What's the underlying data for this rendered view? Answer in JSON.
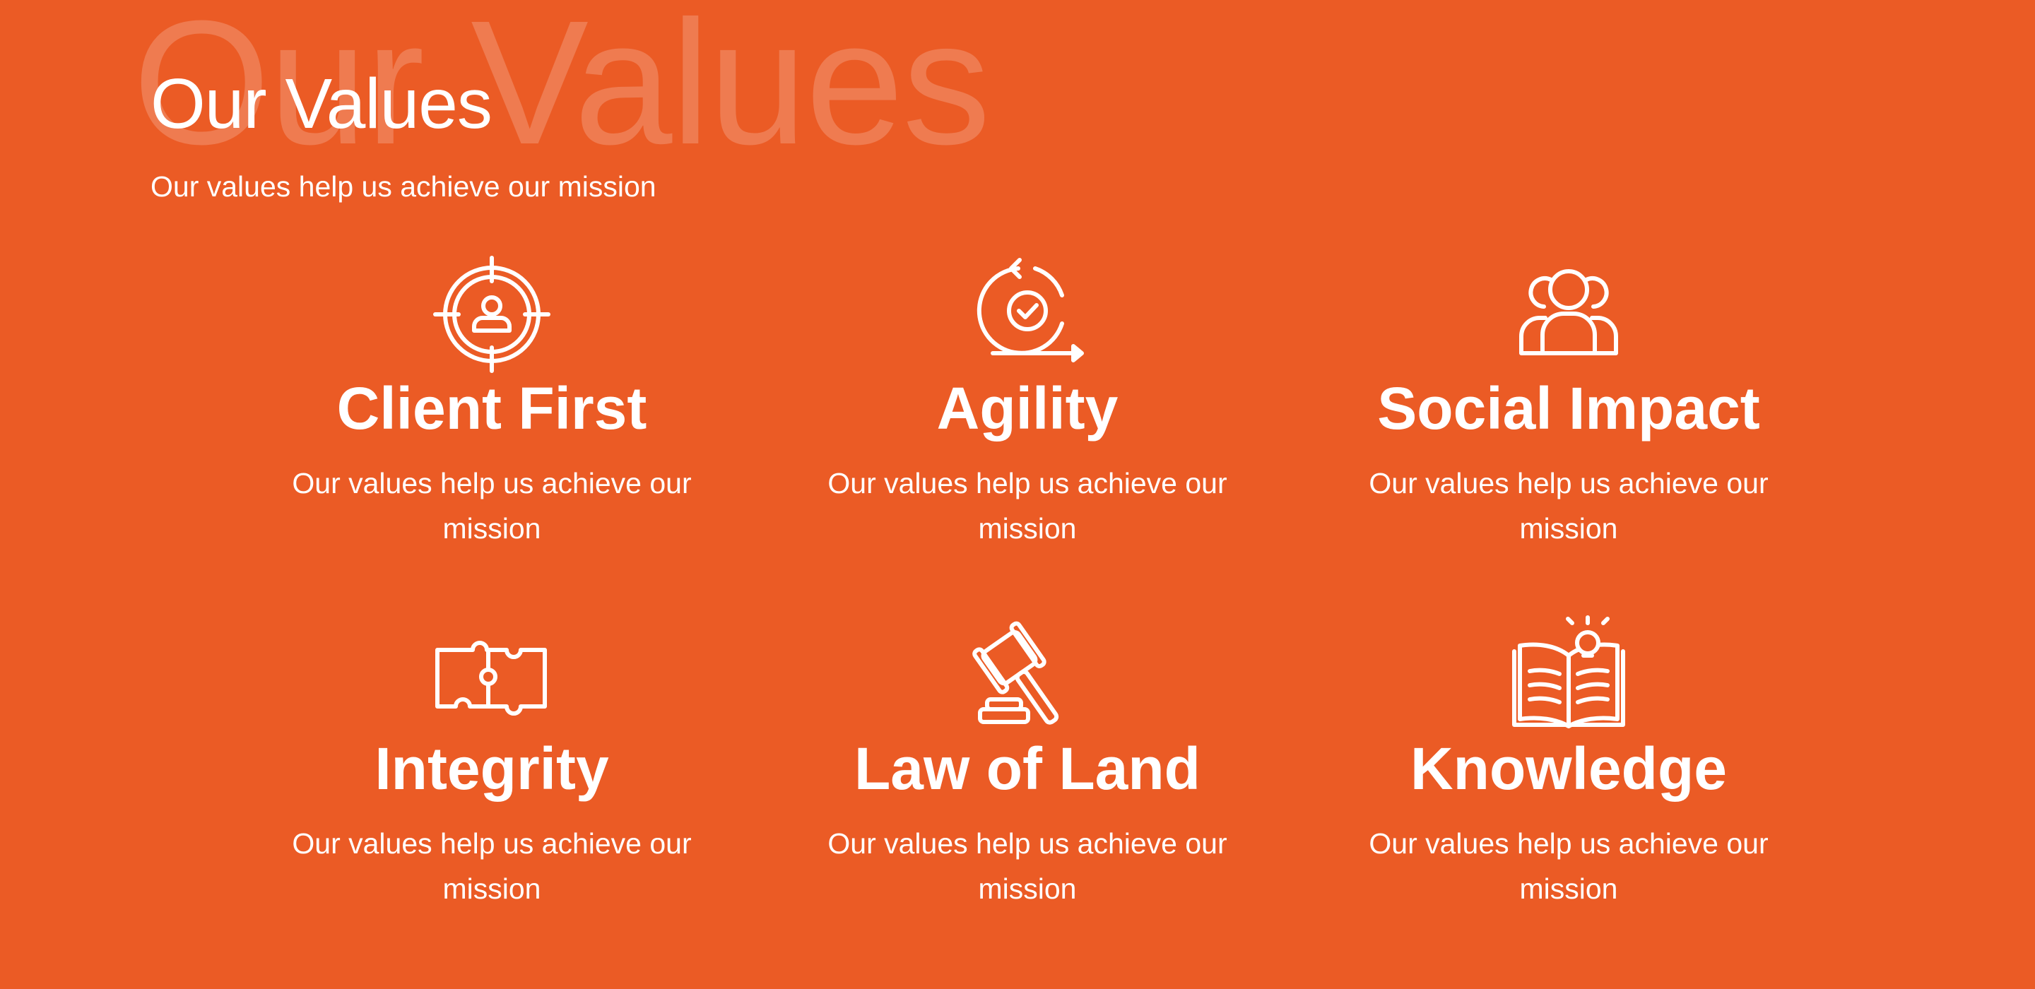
{
  "section": {
    "background_title": "Our Values",
    "title": "Our Values",
    "subtitle": "Our values help us achieve our mission",
    "background_color": "#EB5B25",
    "text_color": "#FFFFFF"
  },
  "values": [
    {
      "title": "Client First",
      "description": "Our values help us achieve our mission",
      "icon": "target-person-icon"
    },
    {
      "title": "Agility",
      "description": "Our values help us achieve our mission",
      "icon": "cycle-check-icon"
    },
    {
      "title": "Social Impact",
      "description": "Our values help us achieve our mission",
      "icon": "people-group-icon"
    },
    {
      "title": "Integrity",
      "description": "Our values help us achieve our mission",
      "icon": "puzzle-icon"
    },
    {
      "title": "Law of Land",
      "description": "Our values help us achieve our mission",
      "icon": "gavel-icon"
    },
    {
      "title": "Knowledge",
      "description": "Our values help us achieve our mission",
      "icon": "book-bulb-icon"
    }
  ]
}
